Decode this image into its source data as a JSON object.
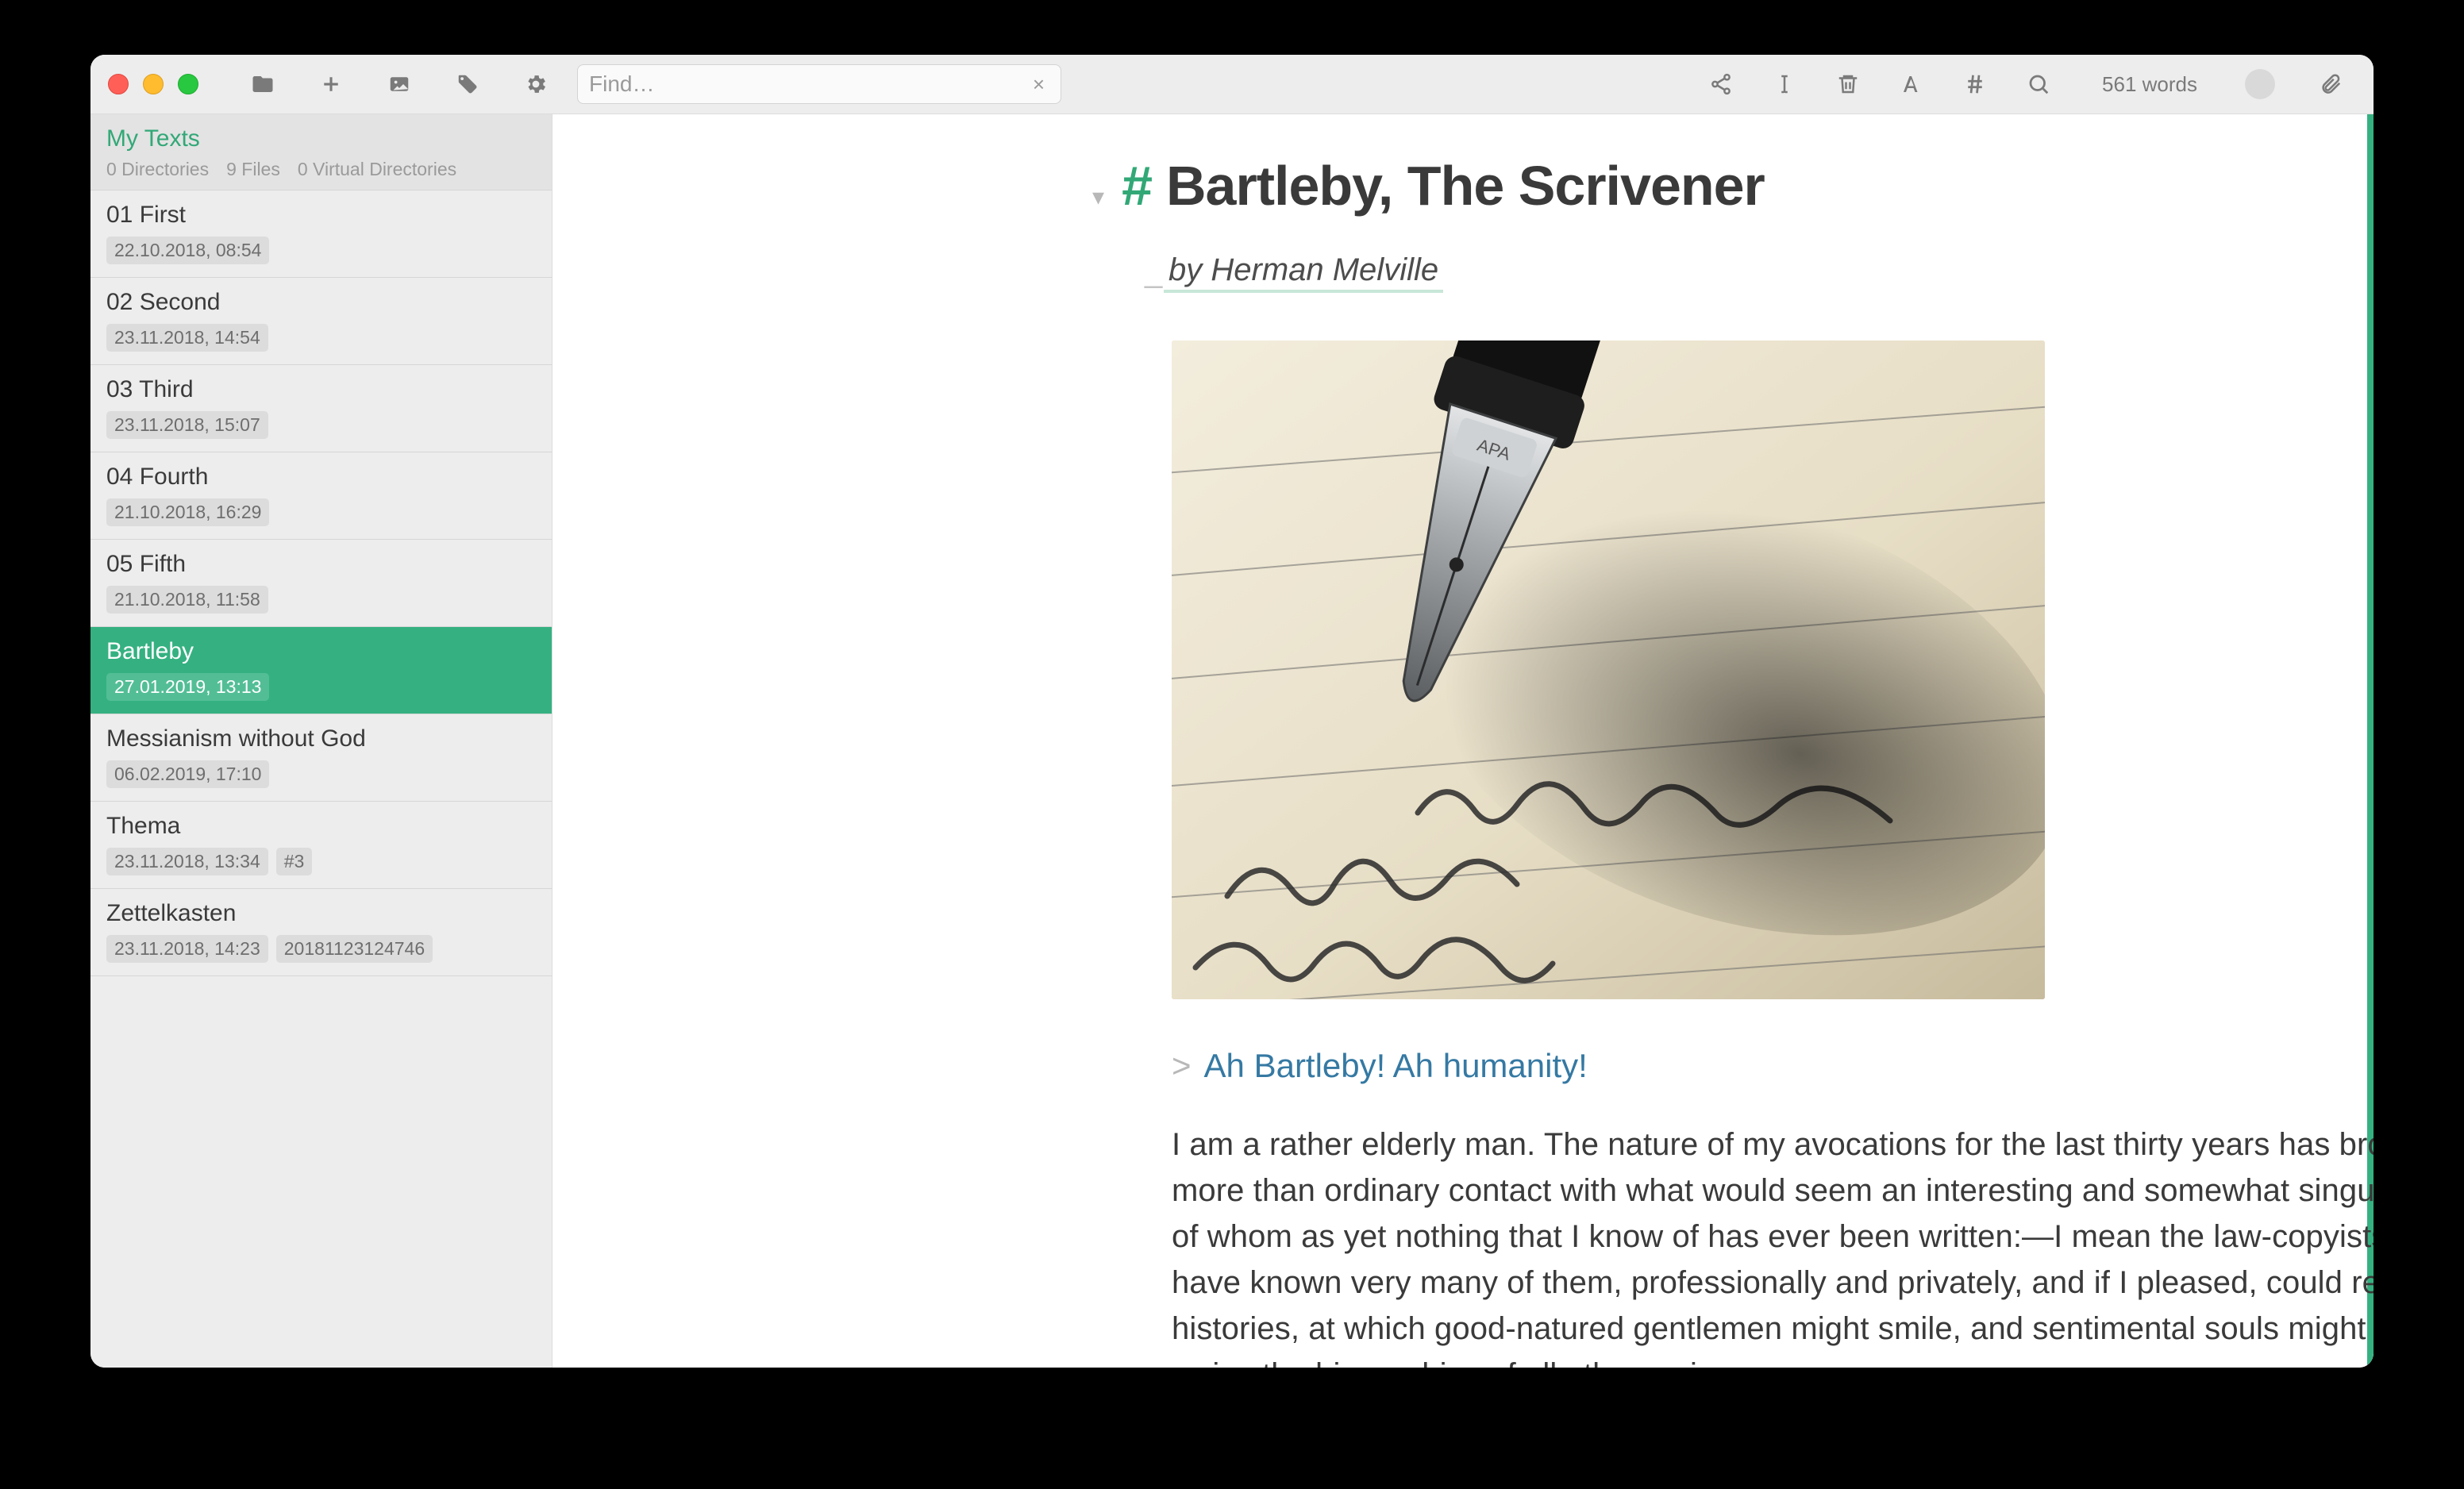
{
  "toolbar": {
    "search_placeholder": "Find…",
    "word_count": "561 words",
    "icons": {
      "folder": "folder-icon",
      "plus": "plus-icon",
      "image": "image-icon",
      "tag": "tag-icon",
      "settings": "gear-icon",
      "share": "share-icon",
      "cursor": "text-cursor-icon",
      "trash": "trash-icon",
      "font": "font-icon",
      "hash": "hash-icon",
      "search": "search-icon",
      "attach": "paperclip-icon"
    }
  },
  "sidebar": {
    "title": "My Texts",
    "meta": {
      "dirs": "0 Directories",
      "files": "9 Files",
      "vdirs": "0 Virtual Directories"
    },
    "files": [
      {
        "name": "01 First",
        "date": "22.10.2018, 08:54",
        "extra": "",
        "selected": false
      },
      {
        "name": "02 Second",
        "date": "23.11.2018, 14:54",
        "extra": "",
        "selected": false
      },
      {
        "name": "03 Third",
        "date": "23.11.2018, 15:07",
        "extra": "",
        "selected": false
      },
      {
        "name": "04 Fourth",
        "date": "21.10.2018, 16:29",
        "extra": "",
        "selected": false
      },
      {
        "name": "05 Fifth",
        "date": "21.10.2018, 11:58",
        "extra": "",
        "selected": false
      },
      {
        "name": "Bartleby",
        "date": "27.01.2019, 13:13",
        "extra": "",
        "selected": true
      },
      {
        "name": "Messianism without God",
        "date": "06.02.2019, 17:10",
        "extra": "",
        "selected": false
      },
      {
        "name": "Thema",
        "date": "23.11.2018, 13:34",
        "extra": "#3",
        "selected": false
      },
      {
        "name": "Zettelkasten",
        "date": "23.11.2018, 14:23",
        "extra": "20181123124746",
        "selected": false
      }
    ]
  },
  "document": {
    "hash": "#",
    "title": "Bartleby, The Scrivener",
    "byline": "by Herman Melville",
    "quote": "Ah Bartleby! Ah humanity!",
    "body": "I am a rather elderly man. The nature of my avocations for the last thirty years has brought me into more than ordinary contact with what would seem an interesting and somewhat singular set of men, of whom as yet nothing that I know of has ever been written:—I mean the law-copyists or scriveners. I have known very many of them, professionally and privately, and if I pleased, could relate divers histories, at which good-natured gentlemen might smile, and sentimental souls might weep. But I waive the biographies of all other scriveners"
  },
  "colors": {
    "accent": "#35b181",
    "quote": "#3579a3"
  }
}
